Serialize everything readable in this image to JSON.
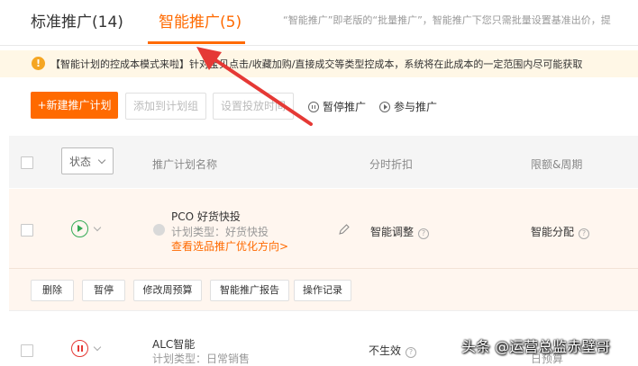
{
  "tabs": [
    {
      "label": "标准推广(14)",
      "active": false
    },
    {
      "label": "智能推广(5)",
      "active": true
    }
  ],
  "tab_description": "“智能推广”即老版的“批量推广”，智能推广下您只需批量设置基准出价，提",
  "notice": {
    "icon": "warning-icon",
    "text": "【智能计划的控成本模式来啦】针对宝贝点击/收藏加购/直接成交等类型控成本，系统将在此成本的一定范围内尽可能获取"
  },
  "toolbar": {
    "new_plan": "+新建推广计划",
    "add_to_group": "添加到计划组",
    "set_time": "设置投放时间",
    "pause": "暂停推广",
    "join": "参与推广"
  },
  "table": {
    "status_select": "状态",
    "columns": [
      "推广计划名称",
      "分时折扣",
      "限额&周期"
    ]
  },
  "rows": [
    {
      "status": "running",
      "name": "PCO 好货快投",
      "type": "计划类型：好货快投",
      "link": "查看选品推广优化方向>",
      "discount": "智能调整",
      "limit": "智能分配",
      "actions": [
        "删除",
        "暂停",
        "修改周预算",
        "智能推广报告",
        "操作记录"
      ]
    },
    {
      "status": "paused",
      "name": "ALC智能",
      "type": "计划类型：日常销售",
      "discount": "不生效",
      "limit_partial": "日预算"
    }
  ],
  "watermark": "头条 @运营总监赤壁哥",
  "colors": {
    "accent": "#ff6a00",
    "play": "#33aa55",
    "pause": "#e53935",
    "arrow": "#e53935"
  }
}
